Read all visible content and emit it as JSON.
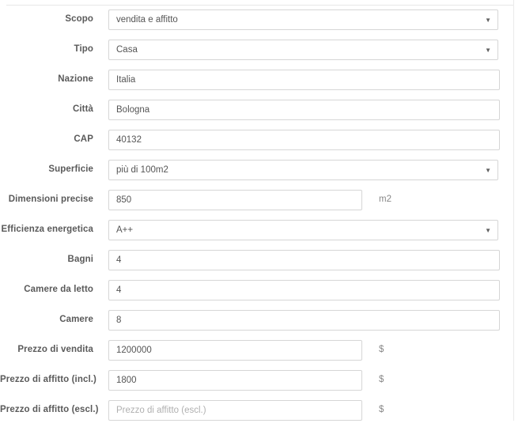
{
  "form": {
    "rows": [
      {
        "label": "Scopo",
        "control": "select",
        "value": "vendita e affitto",
        "placeholder": "",
        "unit": "",
        "width": "wide",
        "name": "scopo"
      },
      {
        "label": "Tipo",
        "control": "select",
        "value": "Casa",
        "placeholder": "",
        "unit": "",
        "width": "wide",
        "name": "tipo"
      },
      {
        "label": "Nazione",
        "control": "text",
        "value": "Italia",
        "placeholder": "",
        "unit": "",
        "width": "wide",
        "name": "nazione"
      },
      {
        "label": "Città",
        "control": "text",
        "value": "Bologna",
        "placeholder": "",
        "unit": "",
        "width": "wide",
        "name": "citta"
      },
      {
        "label": "CAP",
        "control": "text",
        "value": "40132",
        "placeholder": "",
        "unit": "",
        "width": "wide",
        "name": "cap"
      },
      {
        "label": "Superficie",
        "control": "select",
        "value": "più di 100m2",
        "placeholder": "",
        "unit": "",
        "width": "wide",
        "name": "superficie"
      },
      {
        "label": "Dimensioni precise",
        "control": "text",
        "value": "850",
        "placeholder": "",
        "unit": "m2",
        "width": "short",
        "name": "dimensioni-precise"
      },
      {
        "label": "Efficienza energetica",
        "control": "select",
        "value": "A++",
        "placeholder": "",
        "unit": "",
        "width": "wide",
        "name": "efficienza-energetica"
      },
      {
        "label": "Bagni",
        "control": "text",
        "value": "4",
        "placeholder": "",
        "unit": "",
        "width": "wide",
        "name": "bagni"
      },
      {
        "label": "Camere da letto",
        "control": "text",
        "value": "4",
        "placeholder": "",
        "unit": "",
        "width": "wide",
        "name": "camere-da-letto"
      },
      {
        "label": "Camere",
        "control": "text",
        "value": "8",
        "placeholder": "",
        "unit": "",
        "width": "wide",
        "name": "camere"
      },
      {
        "label": "Prezzo di vendita",
        "control": "text",
        "value": "1200000",
        "placeholder": "",
        "unit": "$",
        "width": "short",
        "name": "prezzo-di-vendita"
      },
      {
        "label": "Prezzo di affitto (incl.)",
        "control": "text",
        "value": "1800",
        "placeholder": "",
        "unit": "$",
        "width": "short",
        "name": "prezzo-di-affitto-incl"
      },
      {
        "label": "Prezzo di affitto (escl.)",
        "control": "text",
        "value": "",
        "placeholder": "Prezzo di affitto (escl.)",
        "unit": "$",
        "width": "short",
        "name": "prezzo-di-affitto-escl"
      }
    ],
    "select_arrow_glyph": "▼"
  },
  "colors": {
    "border": "#d6d6d6",
    "label_text": "#5a5a5a",
    "value_text": "#555555",
    "placeholder_text": "#b0b0b0",
    "unit_text": "#888888"
  }
}
